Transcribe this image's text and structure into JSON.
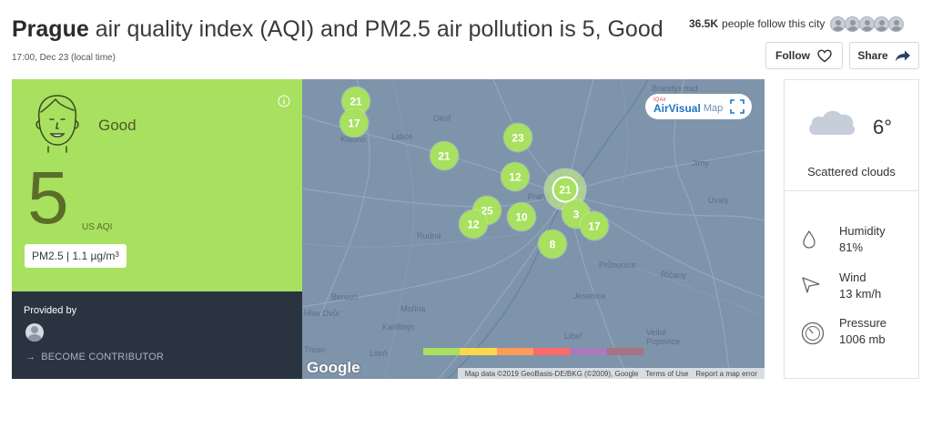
{
  "header": {
    "city": "Prague",
    "title_rest": " air quality index (AQI) and PM2.5 air pollution is 5, Good",
    "timestamp": "17:00, Dec 23 (local time)",
    "followers_count": "36.5K",
    "followers_text": "people follow this city",
    "follow_label": "Follow",
    "share_label": "Share"
  },
  "aqi": {
    "level": "Good",
    "value": "5",
    "unit": "US AQI",
    "pollutant_text": "PM2.5 | 1.1 µg/m",
    "pollutant_sup": "3",
    "panel_color": "#a8e05f"
  },
  "provider": {
    "label": "Provided by",
    "contributor_arrow": "→",
    "contributor_link": "BECOME CONTRIBUTOR"
  },
  "map": {
    "badge_brand": "AirVisual",
    "badge_suffix": "Map",
    "badge_logo": "IQAir",
    "google_logo": "Google",
    "attribution": [
      "Map data ©2019 GeoBasis-DE/BKG (©2009), Google",
      "Terms of Use",
      "Report a map error"
    ],
    "markers": [
      "21",
      "17",
      "21",
      "23",
      "12",
      "21",
      "25",
      "12",
      "10",
      "3",
      "17",
      "8"
    ],
    "places": [
      "Kladno",
      "Lidice",
      "Okoř",
      "Praha",
      "Brandýs nad",
      "Jirny",
      "Úvaly",
      "Rudná",
      "Průhonice",
      "Říčany",
      "Beroun",
      "Mořina",
      "Karlštejn",
      "Jesenice",
      "Libeř",
      "Velké Popovice",
      "Liteň",
      "Tman",
      "Hlav Dvůr"
    ],
    "scale_colors": [
      "#a8e05f",
      "#fdd74b",
      "#fe9b57",
      "#fe6a69",
      "#a97abc",
      "#a87383"
    ]
  },
  "weather": {
    "icon": "cloud-icon",
    "temperature": "6°",
    "condition": "Scattered clouds",
    "humidity_label": "Humidity",
    "humidity_value": "81%",
    "wind_label": "Wind",
    "wind_value": "13 km/h",
    "pressure_label": "Pressure",
    "pressure_value": "1006 mb"
  }
}
